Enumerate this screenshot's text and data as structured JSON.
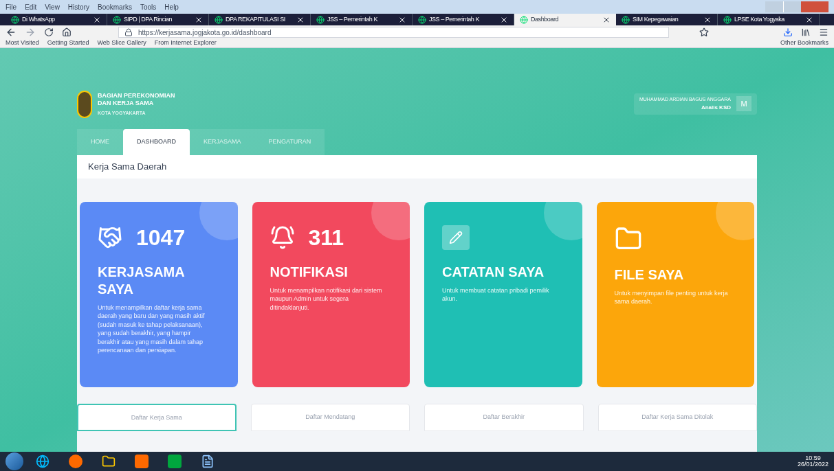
{
  "menu_bar": [
    "File",
    "Edit",
    "View",
    "History",
    "Bookmarks",
    "Tools",
    "Help"
  ],
  "browser_tabs": [
    {
      "title": "Di WhatsApp",
      "selected": false
    },
    {
      "title": "SIPD | DPA Rincian",
      "selected": false
    },
    {
      "title": "DPA REKAPITULASI SI",
      "selected": false
    },
    {
      "title": "JSS – Pemerintah K",
      "selected": false
    },
    {
      "title": "JSS – Pemerintah K",
      "selected": false
    },
    {
      "title": "Dashboard",
      "selected": true
    },
    {
      "title": "SIM Kepegawaian",
      "selected": false
    },
    {
      "title": "LPSE Kota Yogyaka",
      "selected": false
    }
  ],
  "address_bar": {
    "url": "https://kerjasama.jogjakota.go.id/dashboard"
  },
  "bookmarks": [
    "Most Visited",
    "Getting Started",
    "Web Slice Gallery",
    "From Internet Explorer"
  ],
  "other_bookmarks": "Other Bookmarks",
  "header": {
    "org_line_1": "BAGIAN PEREKONOMIAN",
    "org_line_2": "DAN KERJA SAMA",
    "org_city": "KOTA YOGYAKARTA",
    "user_name": "MUHAMMAD ARDIAN BAGUS ANGGARA",
    "user_role": "Analis KSD",
    "avatar": "M"
  },
  "nav_tabs": [
    {
      "label": "HOME",
      "selected": false
    },
    {
      "label": "DASHBOARD",
      "selected": true
    },
    {
      "label": "KERJASAMA",
      "selected": false
    },
    {
      "label": "PENGATURAN",
      "selected": false
    }
  ],
  "section_title": "Kerja Sama Daerah",
  "cards": [
    {
      "kind": "handshake",
      "color": "#5b8af5",
      "count": "1047",
      "title": "KERJASAMA SAYA",
      "description": "Untuk menampilkan daftar kerja sama daerah yang baru dan yang masih aktif (sudah masuk ke tahap pelaksanaan), yang sudah berakhir, yang hampir berakhir atau yang masih dalam tahap perencanaan dan persiapan."
    },
    {
      "kind": "bell",
      "color": "#f2495e",
      "count": "311",
      "title": "NOTIFIKASI",
      "description": "Untuk menampilkan notifikasi dari sistem maupun Admin untuk segera ditindaklanjuti."
    },
    {
      "kind": "note",
      "color": "#1fbfb4",
      "title": "CATATAN SAYA",
      "description": "Untuk membuat catatan pribadi pemilik akun."
    },
    {
      "kind": "folder",
      "color": "#fca60b",
      "title": "FILE SAYA",
      "description": "Untuk menyimpan file penting untuk kerja sama daerah."
    }
  ],
  "lists": [
    {
      "title": "Daftar Kerja Sama",
      "selected": true
    },
    {
      "title": "Daftar Mendatang",
      "selected": false
    },
    {
      "title": "Daftar Berakhir",
      "selected": false
    },
    {
      "title": "Daftar Kerja Sama Ditolak",
      "selected": false
    }
  ],
  "taskbar": {
    "time": "10:59",
    "date": "26/01/2022"
  }
}
